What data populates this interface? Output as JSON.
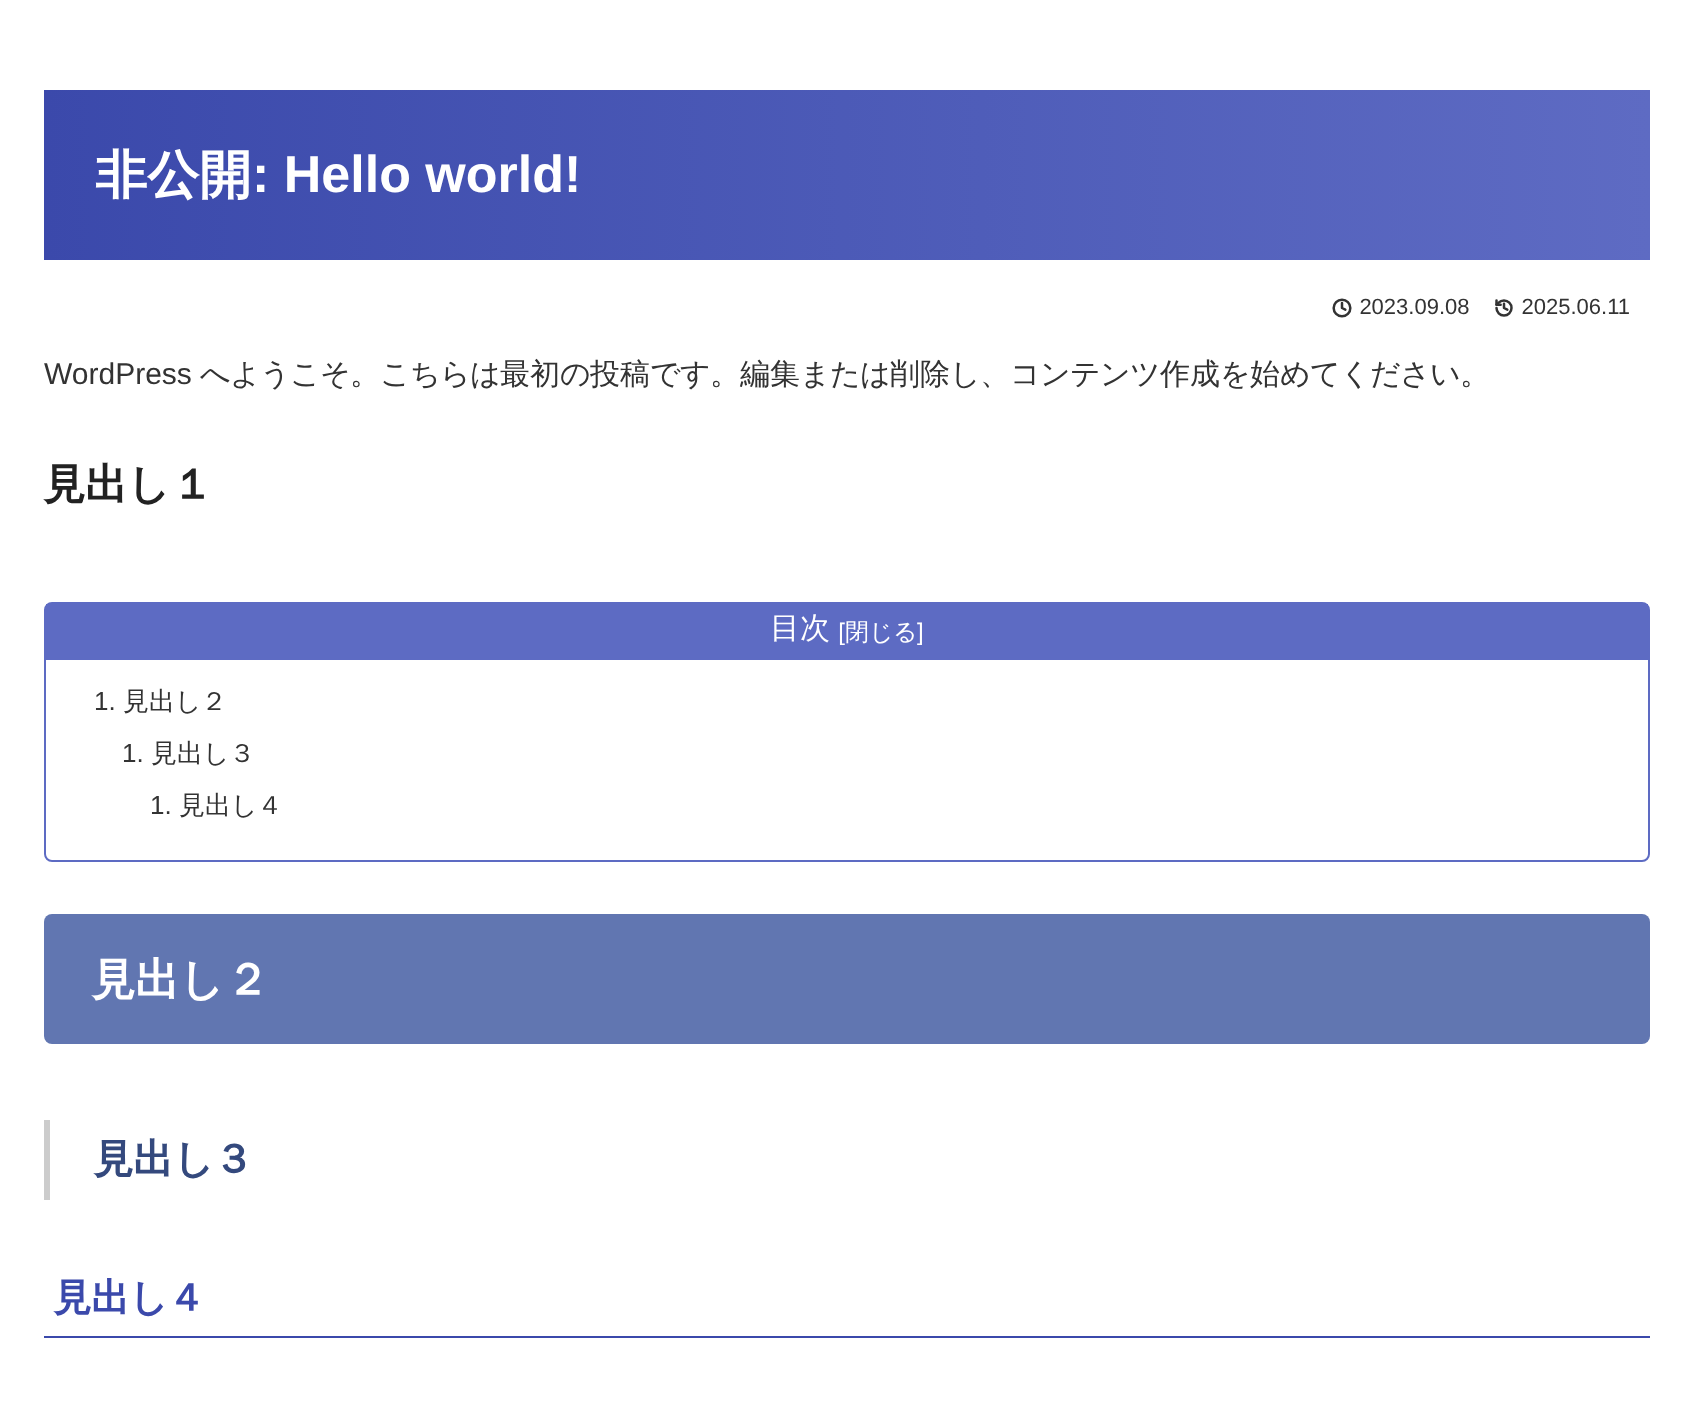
{
  "title": "非公開: Hello world!",
  "meta": {
    "published": "2023.09.08",
    "updated": "2025.06.11"
  },
  "intro": "WordPress へようこそ。こちらは最初の投稿です。編集または削除し、コンテンツ作成を始めてください。",
  "heading1": "見出し１",
  "toc": {
    "title": "目次",
    "toggle": "[閉じる]",
    "items": [
      {
        "number": "1.",
        "label": "見出し２",
        "children": [
          {
            "number": "1.",
            "label": "見出し３",
            "children": [
              {
                "number": "1.",
                "label": "見出し４"
              }
            ]
          }
        ]
      }
    ]
  },
  "heading2": "見出し２",
  "heading3": "見出し３",
  "heading4": "見出し４"
}
